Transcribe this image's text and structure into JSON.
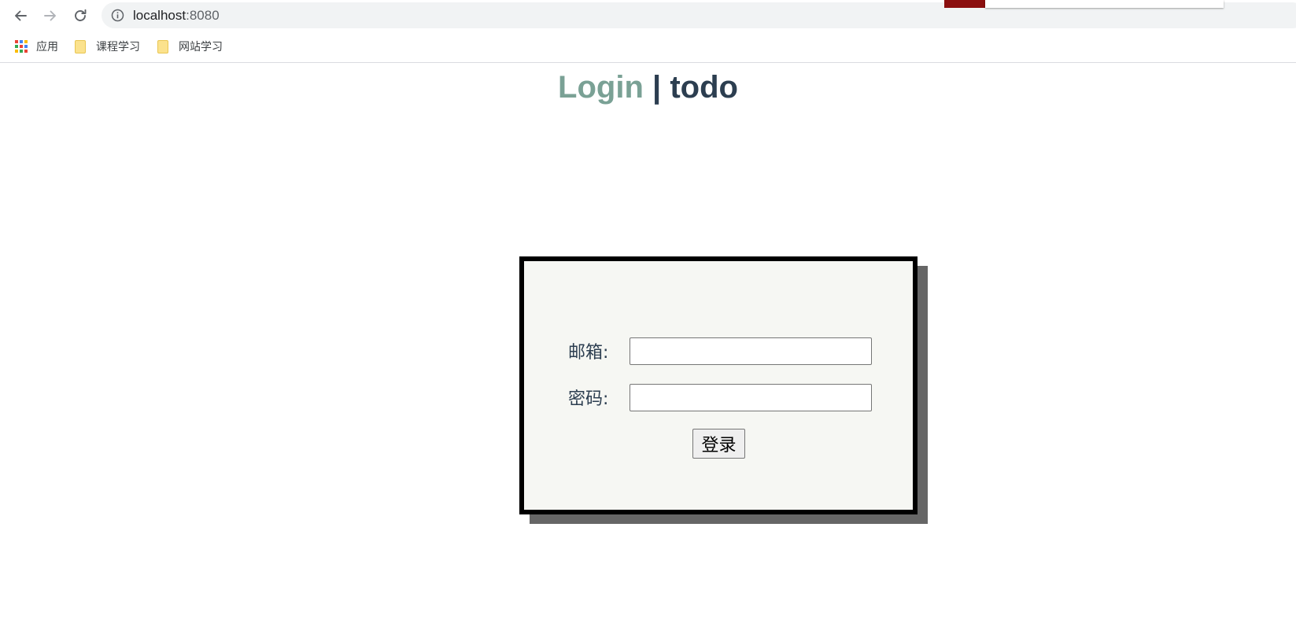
{
  "browser": {
    "url_host": "localhost",
    "url_port": ":8080",
    "bookmarks": [
      {
        "label": "应用",
        "icon": "apps-grid-icon"
      },
      {
        "label": "课程学习",
        "icon": "folder-icon"
      },
      {
        "label": "网站学习",
        "icon": "folder-icon"
      }
    ]
  },
  "header": {
    "login": "Login",
    "separator": "|",
    "todo": "todo"
  },
  "form": {
    "email_label": "邮箱:",
    "email_value": "",
    "password_label": "密码:",
    "password_value": "",
    "submit_label": "登录"
  },
  "colors": {
    "login_accent": "#7aa195",
    "title_dark": "#2c3e50",
    "box_background": "#f6f7f3",
    "box_border": "#000000",
    "box_shadow": "#666666"
  }
}
